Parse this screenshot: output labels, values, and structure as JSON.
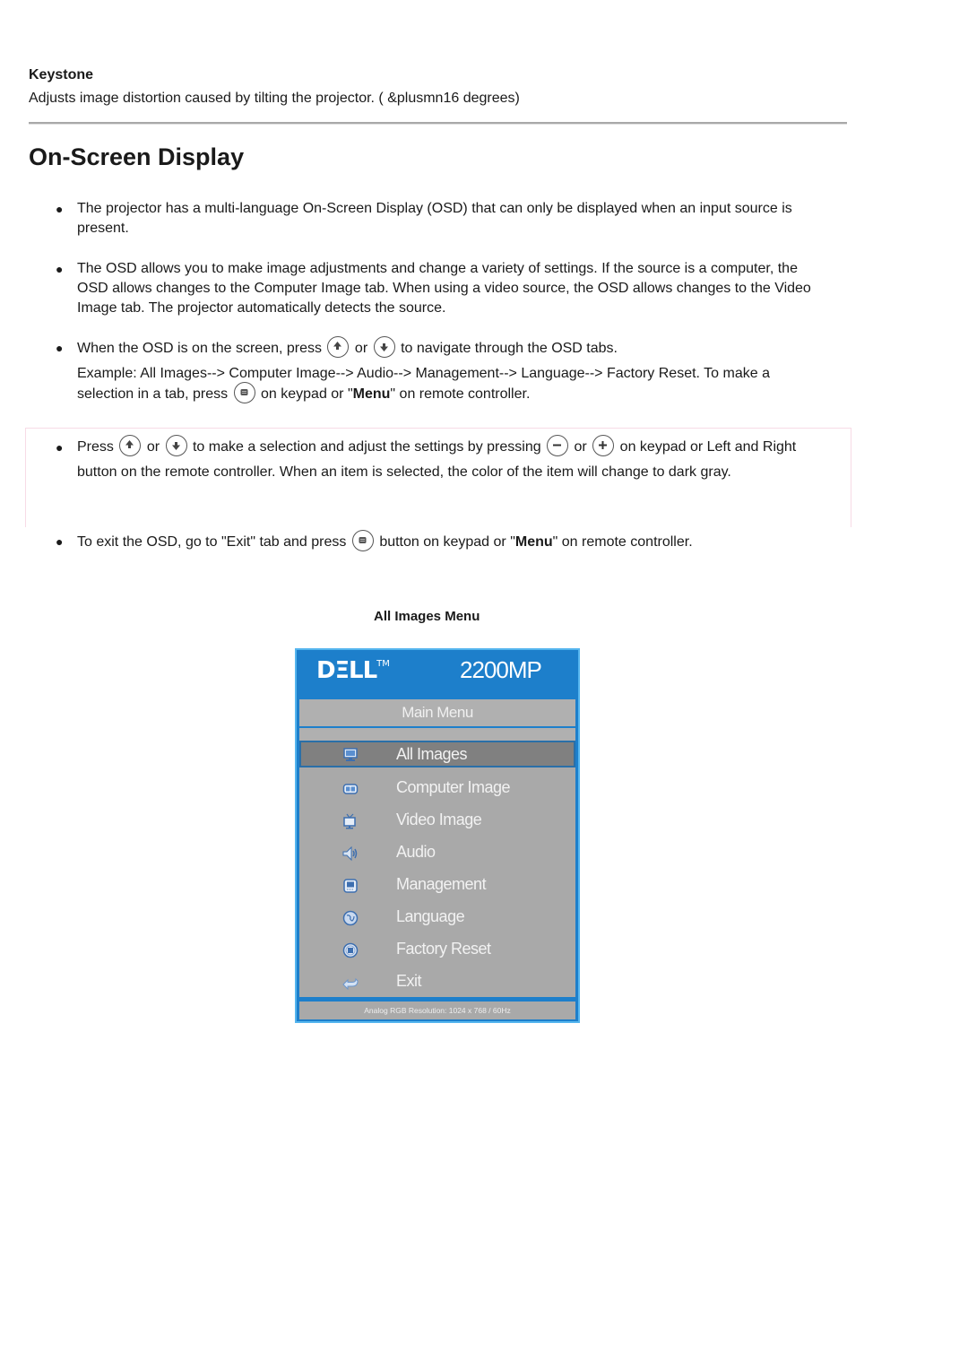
{
  "keystone": {
    "title": "Keystone",
    "description": "Adjusts image distortion caused by tilting the projector. ( &plusmn16 degrees)"
  },
  "section": {
    "title": "On-Screen Display"
  },
  "bullets": {
    "b1": "The projector has a multi-language On-Screen Display (OSD) that can only be displayed when an input source is present.",
    "b2": "The OSD allows you to make image adjustments and change a variety of settings. If the source is a computer, the OSD allows changes to the Computer Image tab. When using a video source, the OSD allows changes to the Video Image tab. The projector automatically detects the source.",
    "b3": {
      "part1": "When the OSD is on the screen, press",
      "part2": "or",
      "part3": "to navigate through the OSD tabs.",
      "example1": "Example: All Images--> Computer Image--> Audio--> Management--> Language--> Factory Reset. To make a selection in a tab, press",
      "example2": "on keypad or \"",
      "example_bold": "Menu",
      "example3": "\" on remote controller."
    },
    "b4": {
      "part1": "Press",
      "part2": "or",
      "part3": "to make a selection and adjust the settings by pressing",
      "part4": "or",
      "part5": "on keypad or Left and Right button on the remote controller. When an item is selected, the color of the item will change to dark gray."
    },
    "b5": {
      "part1": "To exit the OSD, go to \"Exit\" tab and press",
      "part2": "button on keypad or \"",
      "bold": "Menu",
      "part3": "\" on remote controller."
    }
  },
  "icons": {
    "up": "up-button-icon",
    "down": "down-button-icon",
    "menu": "menu-button-icon",
    "minus": "minus-button-icon",
    "plus": "plus-button-icon"
  },
  "osd": {
    "caption": "All Images Menu",
    "brand": "D&LL",
    "brand_display": "DΞLL",
    "trademark": "TM",
    "model": "2200MP",
    "main_menu": "Main Menu",
    "items": [
      {
        "label": "All Images",
        "icon": "monitor-icon",
        "selected": true
      },
      {
        "label": "Computer Image",
        "icon": "computer-image-icon",
        "selected": false
      },
      {
        "label": "Video Image",
        "icon": "tv-icon",
        "selected": false
      },
      {
        "label": "Audio",
        "icon": "speaker-icon",
        "selected": false
      },
      {
        "label": "Management",
        "icon": "management-icon",
        "selected": false
      },
      {
        "label": "Language",
        "icon": "globe-icon",
        "selected": false
      },
      {
        "label": "Factory Reset",
        "icon": "reset-icon",
        "selected": false
      },
      {
        "label": "Exit",
        "icon": "exit-arrow-icon",
        "selected": false
      }
    ],
    "status": "Analog RGB Resolution: 1024 x 768 / 60Hz",
    "colors": {
      "frame": "#1d7fcb",
      "panel": "#a9a9a9",
      "selected": "#808080"
    }
  }
}
